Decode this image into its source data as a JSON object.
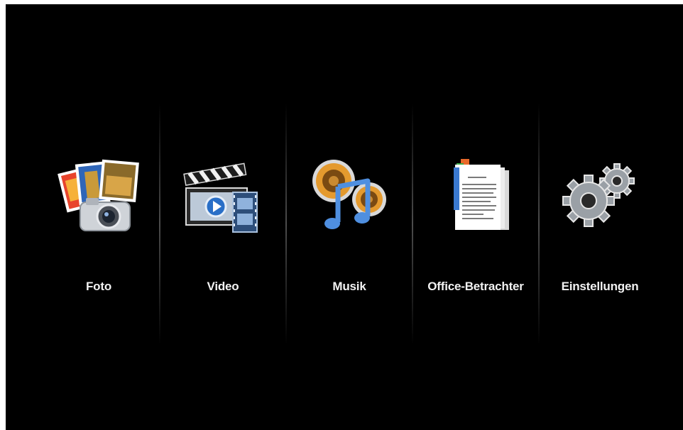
{
  "menu": {
    "items": [
      {
        "label": "Foto",
        "icon": "photo-icon"
      },
      {
        "label": "Video",
        "icon": "video-icon"
      },
      {
        "label": "Musik",
        "icon": "music-icon"
      },
      {
        "label": "Office-Betrachter",
        "icon": "office-document-icon"
      },
      {
        "label": "Einstellungen",
        "icon": "settings-gears-icon"
      }
    ]
  },
  "colors": {
    "background": "#000000",
    "label": "#f2f2f2",
    "divider": "#5a5a5a"
  }
}
